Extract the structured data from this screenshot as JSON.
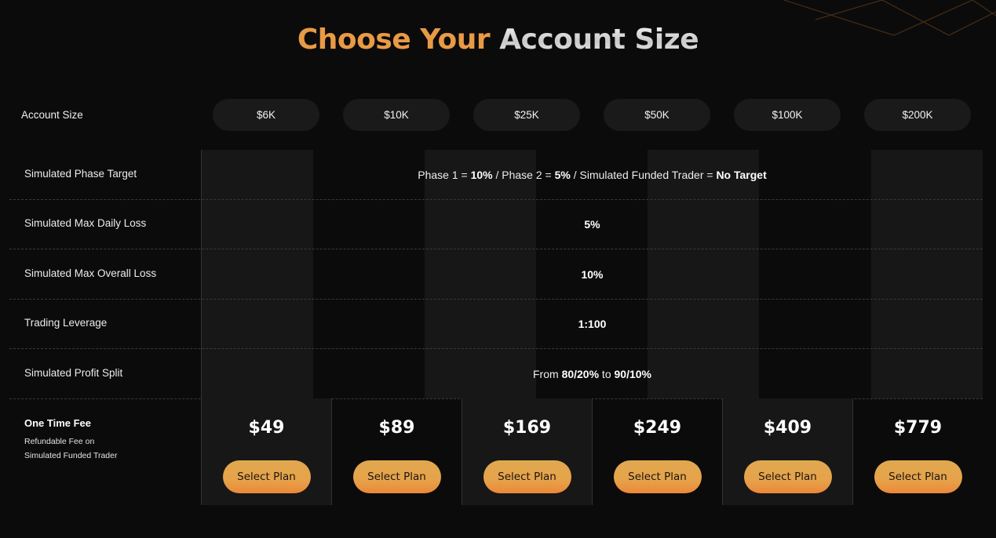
{
  "title": {
    "part1": "Choose Your",
    "part2": "Account Size"
  },
  "colors": {
    "accent": "#e89a45",
    "button_top": "#e0a850",
    "button_bottom": "#ec8738",
    "background": "#0c0b0c",
    "stripe": "#171717"
  },
  "account_size": {
    "label": "Account Size",
    "options": [
      "$6K",
      "$10K",
      "$25K",
      "$50K",
      "$100K",
      "$200K"
    ]
  },
  "rows": [
    {
      "label": "Simulated Phase Target",
      "value_parts": [
        {
          "text": "Phase 1 = ",
          "bold": false
        },
        {
          "text": "10%",
          "bold": true
        },
        {
          "text": " / Phase 2 = ",
          "bold": false
        },
        {
          "text": "5%",
          "bold": true
        },
        {
          "text": " / Simulated Funded Trader = ",
          "bold": false
        },
        {
          "text": "No Target",
          "bold": true
        }
      ]
    },
    {
      "label": "Simulated Max Daily Loss",
      "value_parts": [
        {
          "text": "5%",
          "bold": true
        }
      ]
    },
    {
      "label": "Simulated Max Overall Loss",
      "value_parts": [
        {
          "text": "10%",
          "bold": true
        }
      ]
    },
    {
      "label": "Trading Leverage",
      "value_parts": [
        {
          "text": "1:100",
          "bold": true
        }
      ]
    },
    {
      "label": "Simulated Profit Split",
      "value_parts": [
        {
          "text": "From ",
          "bold": false
        },
        {
          "text": "80/20%",
          "bold": true
        },
        {
          "text": " to ",
          "bold": false
        },
        {
          "text": "90/10%",
          "bold": true
        }
      ]
    }
  ],
  "fee": {
    "title": "One Time Fee",
    "subtitle_line1": "Refundable Fee on",
    "subtitle_line2": "Simulated Funded Trader",
    "prices": [
      "$49",
      "$89",
      "$169",
      "$249",
      "$409",
      "$779"
    ],
    "button_label": "Select Plan"
  }
}
